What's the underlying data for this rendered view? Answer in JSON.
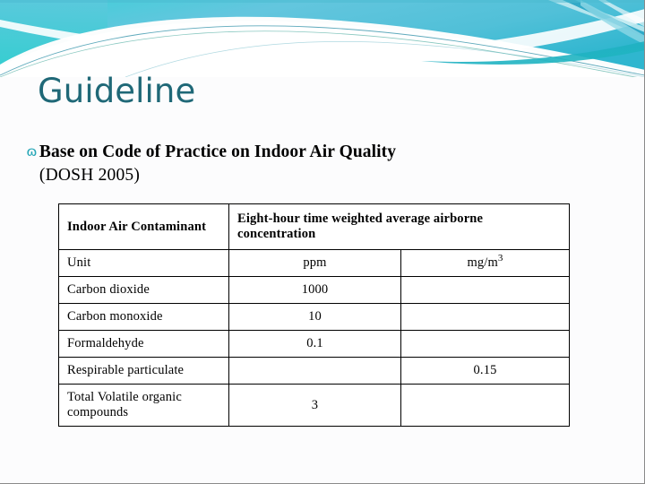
{
  "slide": {
    "title": "Guideline",
    "title_color": "#1f6877",
    "background_color": "#fcfcfd",
    "banner": {
      "accent_color": "#3fc0d4",
      "accent_dark": "#2494ac",
      "accent_light": "#9fe0ea",
      "icon": "flow-swoosh-banner"
    }
  },
  "body": {
    "bullet_glyph": "ɷ",
    "bullet_line1": "Base on Code of Practice on Indoor Air Quality",
    "bullet_line2": "(DOSH 2005)"
  },
  "table": {
    "header": {
      "contaminant": "Indoor Air Contaminant",
      "measure": "Eight-hour time weighted average airborne concentration"
    },
    "unit_row": {
      "label": "Unit",
      "ppm": "ppm",
      "mg": "mg/m",
      "mg_sup": "3"
    },
    "rows": [
      {
        "name": "Carbon dioxide",
        "ppm": "1000",
        "mg": ""
      },
      {
        "name": "Carbon monoxide",
        "ppm": "10",
        "mg": ""
      },
      {
        "name": "Formaldehyde",
        "ppm": "0.1",
        "mg": ""
      },
      {
        "name": "Respirable particulate",
        "ppm": "",
        "mg": "0.15"
      },
      {
        "name": "Total Volatile organic compounds",
        "ppm": "3",
        "mg": ""
      }
    ]
  }
}
